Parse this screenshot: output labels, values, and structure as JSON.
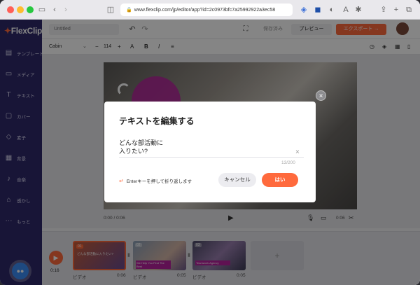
{
  "browser": {
    "url": "www.flexclip.com/jp/editor/app?id=2c0973bfc7a25992922a3ec58",
    "lock_icon": "lock-icon"
  },
  "app": {
    "logo_text": "FlexClip",
    "project_name": "Untitled",
    "save_status": "保存済み",
    "preview_label": "プレビュー",
    "export_label": "エクスポート →"
  },
  "sidebar": {
    "items": [
      {
        "label": "テンプレート",
        "icon": "template-icon"
      },
      {
        "label": "メディア",
        "icon": "folder-icon"
      },
      {
        "label": "テキスト",
        "icon": "text-icon"
      },
      {
        "label": "カバー",
        "icon": "cover-icon"
      },
      {
        "label": "素子",
        "icon": "element-icon"
      },
      {
        "label": "背景",
        "icon": "background-icon"
      },
      {
        "label": "音楽",
        "icon": "music-icon"
      },
      {
        "label": "透かし",
        "icon": "watermark-icon"
      },
      {
        "label": "もっと",
        "icon": "more-icon"
      }
    ]
  },
  "format_bar": {
    "font": "Cabin",
    "font_size": "114",
    "minus": "−",
    "plus": "+",
    "letter_A": "A",
    "bold_B": "B",
    "italic_I": "I"
  },
  "player": {
    "current_time": "0:00 / 0:06",
    "duration": "0:06"
  },
  "timeline": {
    "total_time": "0:16",
    "clips": [
      {
        "name": "ビデオ",
        "time": "0:06",
        "badge": "01",
        "caption": "どんな部活動に入りたい?"
      },
      {
        "name": "ビデオ",
        "time": "0:05",
        "badge": "02",
        "caption": "We Help You Find The Best"
      },
      {
        "name": "ビデオ",
        "time": "0:05",
        "badge": "03",
        "caption": "Teamwork Agency"
      }
    ],
    "add_label": "+"
  },
  "modal": {
    "title": "テキストを編集する",
    "text": "どんな部活動に\n入りたい?",
    "counter": "13/200",
    "hint": "Enterキーを押して折り返します",
    "cancel_label": "キャンセル",
    "ok_label": "はい",
    "close_icon": "close-icon"
  },
  "colors": {
    "brand_orange": "#ff6a3d",
    "sidebar_purple": "#2f2a6a",
    "chat_blue": "#3b8cf5"
  }
}
